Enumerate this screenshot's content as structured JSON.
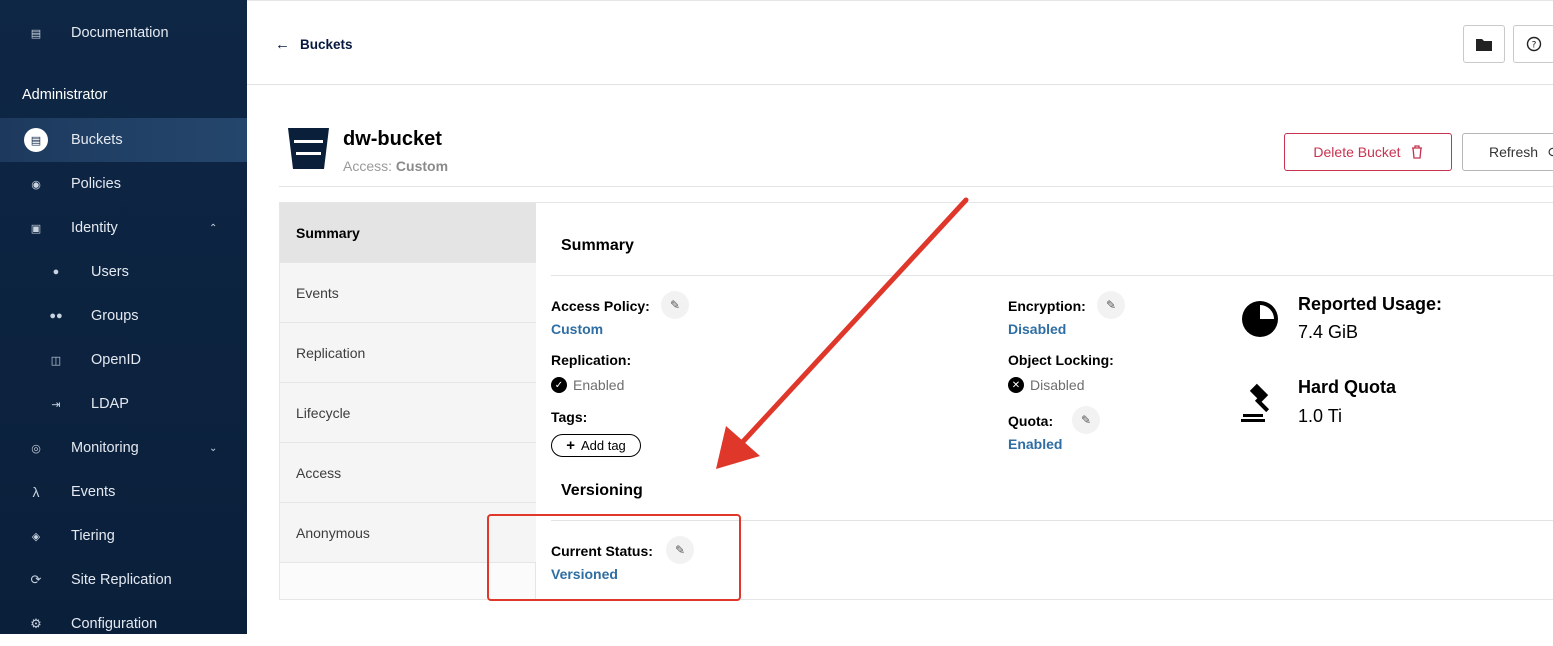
{
  "sidebar": {
    "documentation_label": "Documentation",
    "admin_heading": "Administrator",
    "items": [
      {
        "label": "Buckets"
      },
      {
        "label": "Policies"
      },
      {
        "label": "Identity"
      },
      {
        "label": "Users"
      },
      {
        "label": "Groups"
      },
      {
        "label": "OpenID"
      },
      {
        "label": "LDAP"
      },
      {
        "label": "Monitoring"
      },
      {
        "label": "Events"
      },
      {
        "label": "Tiering"
      },
      {
        "label": "Site Replication"
      },
      {
        "label": "Configuration"
      }
    ]
  },
  "topbar": {
    "back_label": "Buckets"
  },
  "bucket": {
    "name": "dw-bucket",
    "access_prefix": "Access:",
    "access_value": "Custom",
    "delete_label": "Delete Bucket",
    "refresh_label": "Refresh"
  },
  "tabs": [
    {
      "label": "Summary"
    },
    {
      "label": "Events"
    },
    {
      "label": "Replication"
    },
    {
      "label": "Lifecycle"
    },
    {
      "label": "Access"
    },
    {
      "label": "Anonymous"
    }
  ],
  "summary": {
    "title": "Summary",
    "access_policy_label": "Access Policy:",
    "access_policy_value": "Custom",
    "replication_label": "Replication:",
    "replication_value": "Enabled",
    "tags_label": "Tags:",
    "add_tag_label": "Add tag",
    "encryption_label": "Encryption:",
    "encryption_value": "Disabled",
    "object_locking_label": "Object Locking:",
    "object_locking_value": "Disabled",
    "quota_label": "Quota:",
    "quota_value": "Enabled",
    "reported_usage_label": "Reported Usage:",
    "reported_usage_value": "7.4 GiB",
    "hard_quota_label": "Hard Quota",
    "hard_quota_value": "1.0 Ti"
  },
  "versioning": {
    "title": "Versioning",
    "current_status_label": "Current Status:",
    "current_status_value": "Versioned"
  },
  "colors": {
    "sidebar_bg": "#0e2745",
    "link_blue": "#2f6ea3",
    "delete_red": "#c8334f",
    "annotation_red": "#e0372b"
  }
}
